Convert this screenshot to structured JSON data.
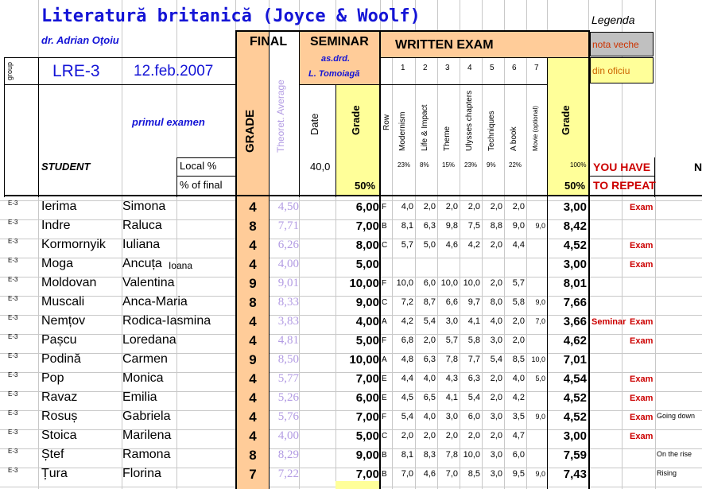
{
  "header": {
    "title": "Literatură britanică (Joyce & Woolf)",
    "author": "dr. Adrian Oţoiu",
    "group_label": "group",
    "group_code": "LRE-3",
    "exam_date": "12.feb.2007",
    "exam_name": "primul examen",
    "student_label": "STUDENT",
    "local_pct_label": "Local %",
    "pct_final_label": "% of final"
  },
  "legend": {
    "title": "Legenda",
    "old_grade": "nota veche",
    "ex_officio": "din oficiu",
    "old_grade_color": "#c0c0c0",
    "ex_officio_color": "#ffff99"
  },
  "columns": {
    "final": "FINAL",
    "grade": "GRADE",
    "theoret_avg": "Theoret. Average",
    "seminar": "SEMINAR",
    "seminar_teacher_1": "as.drd.",
    "seminar_teacher_2": "L. Tomoiagă",
    "date": "Date",
    "seminar_grade": "Grade",
    "seminar_local": "40,0",
    "seminar_final": "50%",
    "written_exam": "WRITTEN EXAM",
    "row": "Row",
    "topic_numbers": [
      "1",
      "2",
      "3",
      "4",
      "5",
      "6",
      "7"
    ],
    "topics": [
      "Modernism",
      "Life & Impact",
      "Theme",
      "Ulysses chapters",
      "Techniques",
      "A book",
      "Movie (optional)"
    ],
    "topic_pcts": [
      "23%",
      "8%",
      "15%",
      "23%",
      "9%",
      "22%",
      ""
    ],
    "written_grade": "Grade",
    "written_local": "100%",
    "written_final": "50%",
    "repeat_1": "YOU HAVE",
    "repeat_2": "TO REPEAT",
    "notes_partial": "N"
  },
  "colors": {
    "peach": "#ffcc99",
    "yellow": "#ffff99",
    "blue_text": "#1414d6",
    "avg_text": "#b39ce3",
    "red_text": "#cc0000"
  },
  "students": [
    {
      "grp": "E-3",
      "last": "Ierima",
      "first": "Simona",
      "extra": "",
      "final": "4",
      "avg": "4,50",
      "sem": "6,00",
      "row": "F",
      "scores": [
        "4,0",
        "2,0",
        "2,0",
        "2,0",
        "2,0",
        "2,0"
      ],
      "movie": "",
      "written": "3,00",
      "seminar_flag": "",
      "exam_flag": "Exam",
      "note": ""
    },
    {
      "grp": "E-3",
      "last": "Indre",
      "first": "Raluca",
      "extra": "",
      "final": "8",
      "avg": "7,71",
      "sem": "7,00",
      "row": "B",
      "scores": [
        "8,1",
        "6,3",
        "9,8",
        "7,5",
        "8,8",
        "9,0"
      ],
      "movie": "9,0",
      "written": "8,42",
      "seminar_flag": "",
      "exam_flag": "",
      "note": ""
    },
    {
      "grp": "E-3",
      "last": "Kormornyik",
      "first": "Iuliana",
      "extra": "",
      "final": "4",
      "avg": "6,26",
      "sem": "8,00",
      "row": "C",
      "scores": [
        "5,7",
        "5,0",
        "4,6",
        "4,2",
        "2,0",
        "4,4"
      ],
      "movie": "",
      "written": "4,52",
      "seminar_flag": "",
      "exam_flag": "Exam",
      "note": ""
    },
    {
      "grp": "E-3",
      "last": "Moga",
      "first": "Ancuța",
      "extra": "Ioana",
      "final": "4",
      "avg": "4,00",
      "sem": "5,00",
      "row": "",
      "scores": [
        "",
        "",
        "",
        "",
        "",
        ""
      ],
      "movie": "",
      "written": "3,00",
      "seminar_flag": "",
      "exam_flag": "Exam",
      "note": ""
    },
    {
      "grp": "E-3",
      "last": "Moldovan",
      "first": "Valentina",
      "extra": "",
      "final": "9",
      "avg": "9,01",
      "sem": "10,00",
      "row": "F",
      "scores": [
        "10,0",
        "6,0",
        "10,0",
        "10,0",
        "2,0",
        "5,7"
      ],
      "movie": "",
      "written": "8,01",
      "seminar_flag": "",
      "exam_flag": "",
      "note": ""
    },
    {
      "grp": "E-3",
      "last": "Muscali",
      "first": "Anca-Maria",
      "extra": "",
      "final": "8",
      "avg": "8,33",
      "sem": "9,00",
      "row": "C",
      "scores": [
        "7,2",
        "8,7",
        "6,6",
        "9,7",
        "8,0",
        "5,8"
      ],
      "movie": "9,0",
      "written": "7,66",
      "seminar_flag": "",
      "exam_flag": "",
      "note": ""
    },
    {
      "grp": "E-3",
      "last": "Nemțov",
      "first": "Rodica-Iasmina",
      "extra": "",
      "final": "4",
      "avg": "3,83",
      "sem": "4,00",
      "row": "A",
      "scores": [
        "4,2",
        "5,4",
        "3,0",
        "4,1",
        "4,0",
        "2,0"
      ],
      "movie": "7,0",
      "written": "3,66",
      "seminar_flag": "Seminar",
      "exam_flag": "Exam",
      "note": ""
    },
    {
      "grp": "E-3",
      "last": "Pașcu",
      "first": "Loredana",
      "extra": "",
      "final": "4",
      "avg": "4,81",
      "sem": "5,00",
      "row": "F",
      "scores": [
        "6,8",
        "2,0",
        "5,7",
        "5,8",
        "3,0",
        "2,0"
      ],
      "movie": "",
      "written": "4,62",
      "seminar_flag": "",
      "exam_flag": "Exam",
      "note": ""
    },
    {
      "grp": "E-3",
      "last": "Podină",
      "first": "Carmen",
      "extra": "",
      "final": "9",
      "avg": "8,50",
      "sem": "10,00",
      "row": "A",
      "scores": [
        "4,8",
        "6,3",
        "7,8",
        "7,7",
        "5,4",
        "8,5"
      ],
      "movie": "10,0",
      "written": "7,01",
      "seminar_flag": "",
      "exam_flag": "",
      "note": ""
    },
    {
      "grp": "E-3",
      "last": "Pop",
      "first": "Monica",
      "extra": "",
      "final": "4",
      "avg": "5,77",
      "sem": "7,00",
      "row": "E",
      "scores": [
        "4,4",
        "4,0",
        "4,3",
        "6,3",
        "2,0",
        "4,0"
      ],
      "movie": "5,0",
      "written": "4,54",
      "seminar_flag": "",
      "exam_flag": "Exam",
      "note": ""
    },
    {
      "grp": "E-3",
      "last": "Ravaz",
      "first": "Emilia",
      "extra": "",
      "final": "4",
      "avg": "5,26",
      "sem": "6,00",
      "row": "E",
      "scores": [
        "4,5",
        "6,5",
        "4,1",
        "5,4",
        "2,0",
        "4,2"
      ],
      "movie": "",
      "written": "4,52",
      "seminar_flag": "",
      "exam_flag": "Exam",
      "note": ""
    },
    {
      "grp": "E-3",
      "last": "Rosuș",
      "first": "Gabriela",
      "extra": "",
      "final": "4",
      "avg": "5,76",
      "sem": "7,00",
      "row": "F",
      "scores": [
        "5,4",
        "4,0",
        "3,0",
        "6,0",
        "3,0",
        "3,5"
      ],
      "movie": "9,0",
      "written": "4,52",
      "seminar_flag": "",
      "exam_flag": "Exam",
      "note": "Going down"
    },
    {
      "grp": "E-3",
      "last": "Stoica",
      "first": "Marilena",
      "extra": "",
      "final": "4",
      "avg": "4,00",
      "sem": "5,00",
      "row": "C",
      "scores": [
        "2,0",
        "2,0",
        "2,0",
        "2,0",
        "2,0",
        "4,7"
      ],
      "movie": "",
      "written": "3,00",
      "seminar_flag": "",
      "exam_flag": "Exam",
      "note": ""
    },
    {
      "grp": "E-3",
      "last": "Ștef",
      "first": "Ramona",
      "extra": "",
      "final": "8",
      "avg": "8,29",
      "sem": "9,00",
      "row": "B",
      "scores": [
        "8,1",
        "8,3",
        "7,8",
        "10,0",
        "3,0",
        "6,0"
      ],
      "movie": "",
      "written": "7,59",
      "seminar_flag": "",
      "exam_flag": "",
      "note": "On the rise"
    },
    {
      "grp": "E-3",
      "last": "Țura",
      "first": "Florina",
      "extra": "",
      "final": "7",
      "avg": "7,22",
      "sem": "7,00",
      "row": "B",
      "scores": [
        "7,0",
        "4,6",
        "7,0",
        "8,5",
        "3,0",
        "9,5"
      ],
      "movie": "9,0",
      "written": "7,43",
      "seminar_flag": "",
      "exam_flag": "",
      "note": "Rising"
    }
  ]
}
